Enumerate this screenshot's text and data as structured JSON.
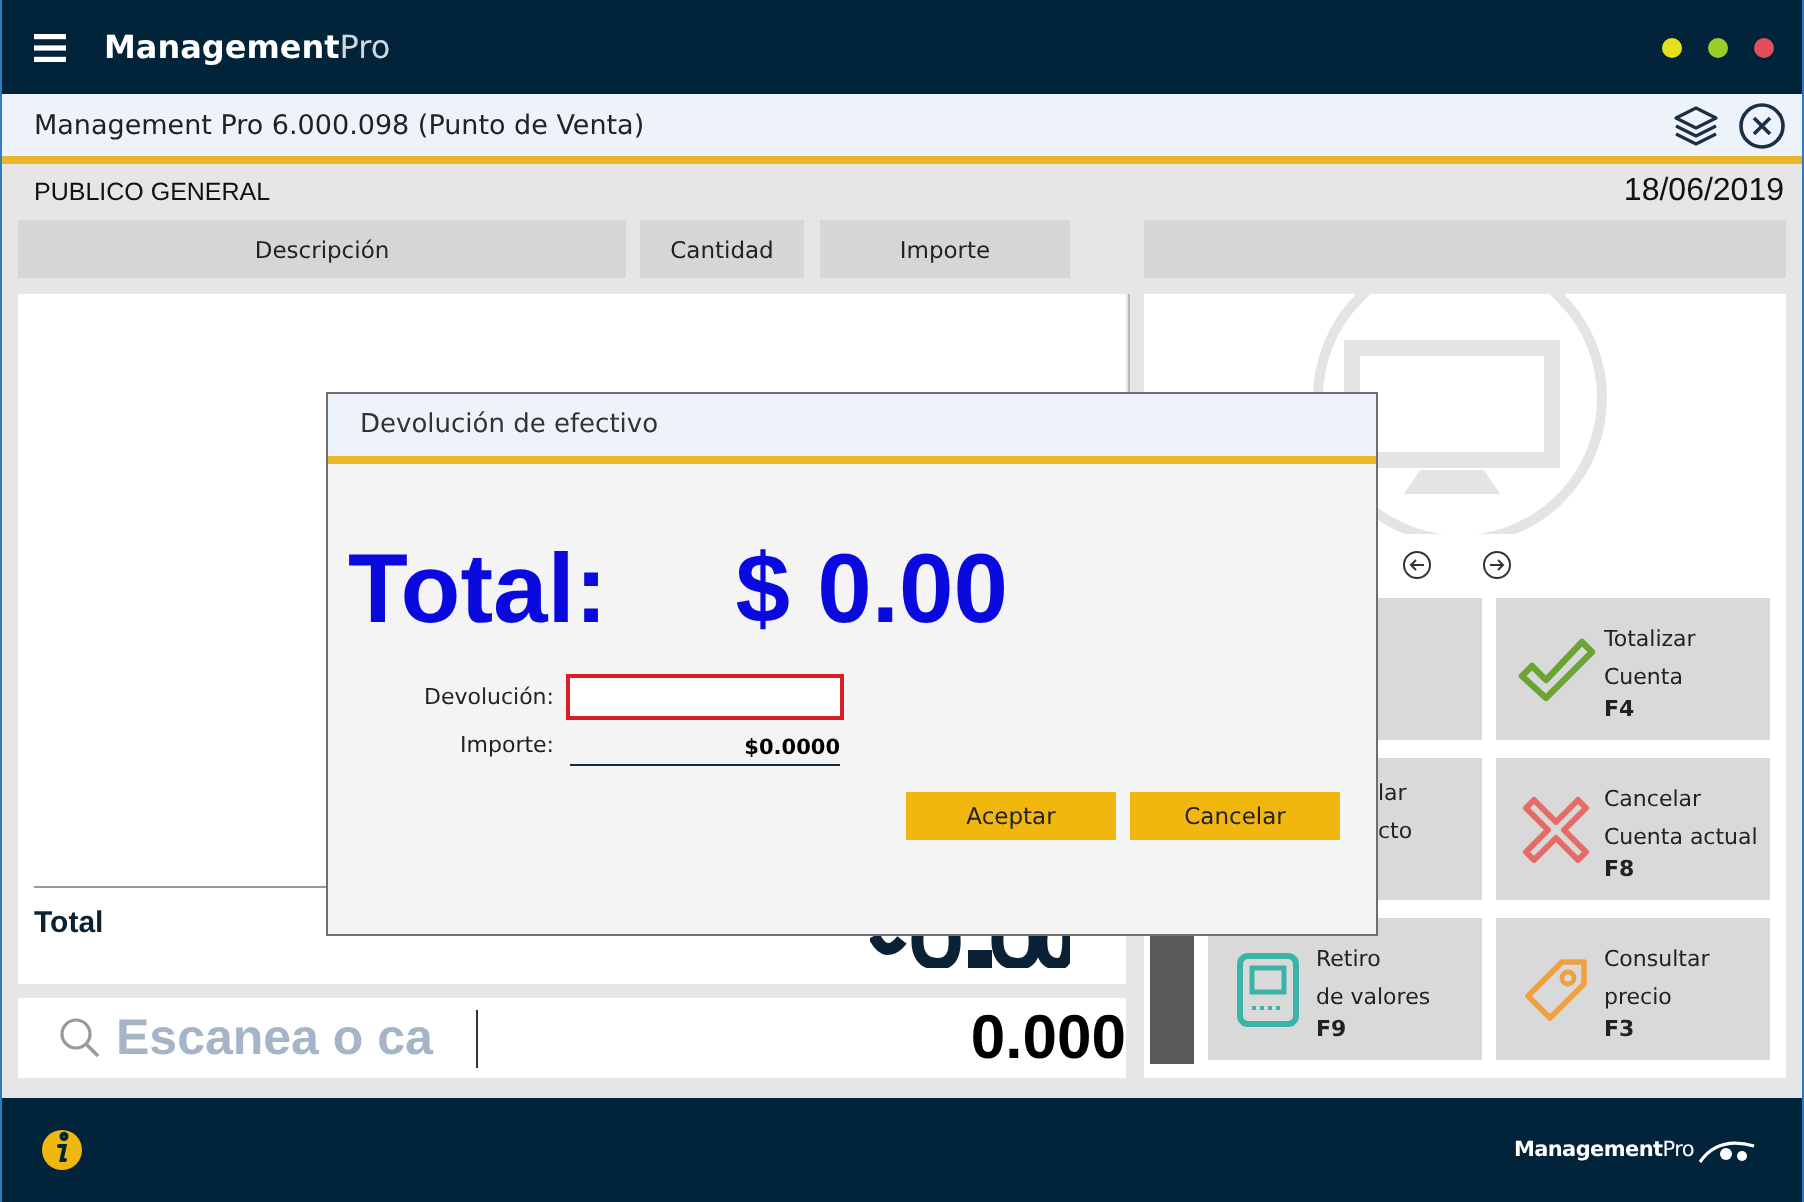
{
  "header": {
    "logo": "**Management**Pro",
    "window_controls": [
      {
        "color": "#e8e01c"
      },
      {
        "color": "#9ccc2a"
      },
      {
        "color": "#e0505a"
      }
    ]
  },
  "title_bar": {
    "title": "Management Pro 6.000.098 (Punto de Venta)"
  },
  "customer": "PUBLICO GENERAL",
  "date": "18/06/2019",
  "columns": [
    "Descripción",
    "Cantidad",
    "Importe"
  ],
  "total": {
    "label": "Total"
  },
  "search": {
    "placeholder": "Escanea o ca",
    "quantity": "0.000"
  },
  "tiles": [
    {
      "kind": "covered"
    },
    {
      "kind": "check",
      "lines": [
        "Totalizar",
        "Cuenta"
      ],
      "key": "F4"
    },
    {
      "kind": "covered",
      "lines": [
        "lar",
        "cto"
      ]
    },
    {
      "kind": "cross",
      "lines": [
        "Cancelar",
        "Cuenta actual"
      ],
      "key": "F8"
    },
    {
      "kind": "terminal",
      "lines": [
        "Retiro",
        "de valores"
      ],
      "key": "F9"
    },
    {
      "kind": "tag",
      "lines": [
        "Consultar",
        "precio"
      ],
      "key": "F3"
    }
  ],
  "dialog": {
    "title": "Devolución de efectivo",
    "total_label": "Total:",
    "total_value": "$ 0.00",
    "fields": [
      {
        "kind": "input",
        "label": "Devolución:"
      },
      {
        "kind": "readout",
        "label": "Importe:",
        "value": "$0.0000"
      }
    ],
    "buttons": [
      "Aceptar",
      "Cancelar"
    ]
  },
  "footer": {
    "logo": "**Management**Pro"
  }
}
